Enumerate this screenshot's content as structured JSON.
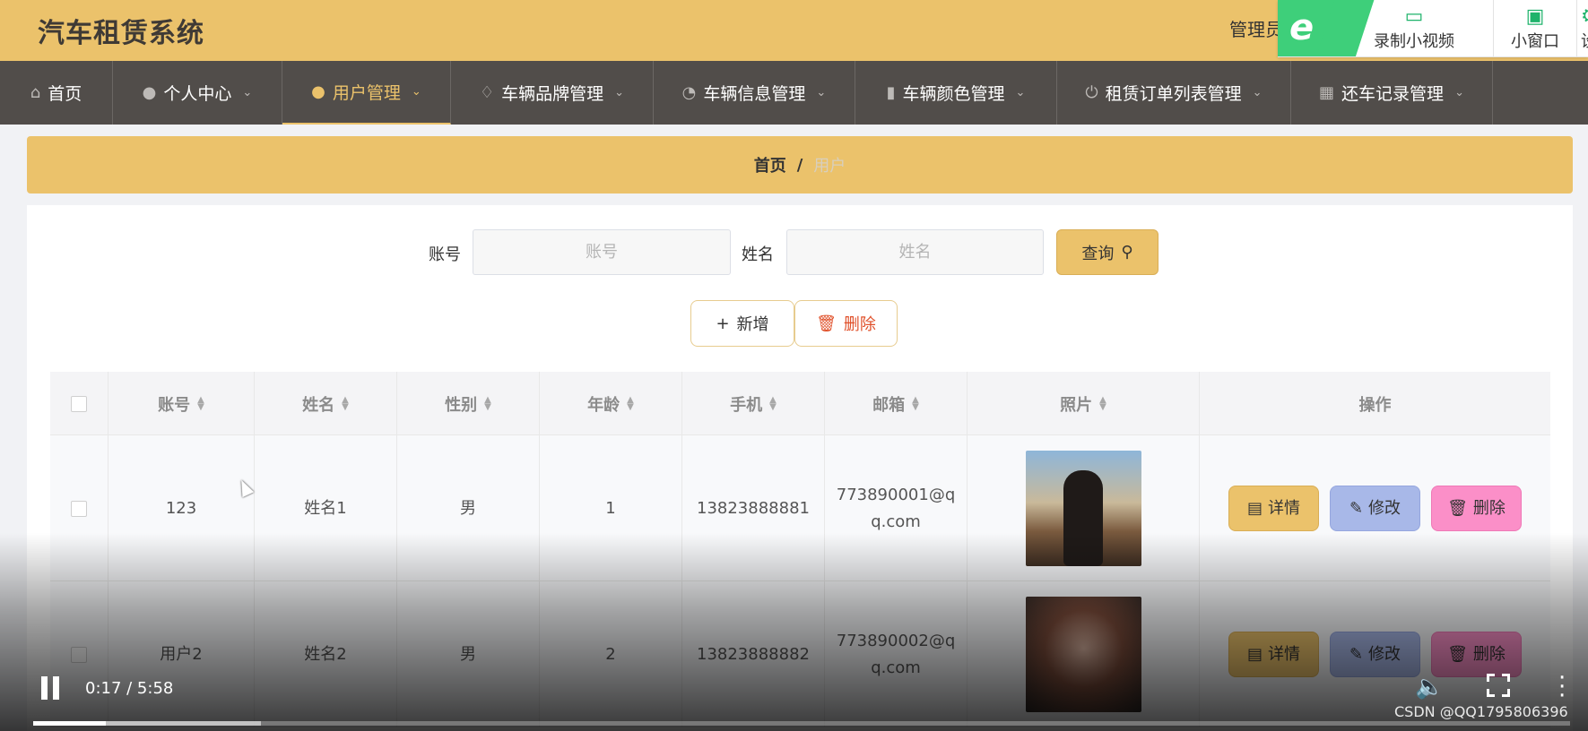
{
  "app": {
    "title": "汽车租赁系统",
    "admin_label": "管理员"
  },
  "recorder": {
    "logo_glyph": "e",
    "items": [
      {
        "label": "录制小视频",
        "icon": "video-camera-icon",
        "glyph": "▭"
      },
      {
        "label": "小窗口",
        "icon": "tv-icon",
        "glyph": "▣"
      },
      {
        "label": "设置",
        "icon": "gear-icon",
        "glyph": "⚙"
      }
    ]
  },
  "nav": {
    "items": [
      {
        "label": "首页",
        "icon": "home-icon",
        "glyph": "⌂",
        "has_caret": false,
        "active": false
      },
      {
        "label": "个人中心",
        "icon": "user-icon",
        "glyph": "●",
        "has_caret": true,
        "active": false
      },
      {
        "label": "用户管理",
        "icon": "user-icon",
        "glyph": "●",
        "has_caret": true,
        "active": true
      },
      {
        "label": "车辆品牌管理",
        "icon": "bell-off-icon",
        "glyph": "♢",
        "has_caret": true,
        "active": false
      },
      {
        "label": "车辆信息管理",
        "icon": "gauge-icon",
        "glyph": "◔",
        "has_caret": true,
        "active": false
      },
      {
        "label": "车辆颜色管理",
        "icon": "bar-chart-icon",
        "glyph": "▮",
        "has_caret": true,
        "active": false
      },
      {
        "label": "租赁订单列表管理",
        "icon": "power-icon",
        "glyph": "⏻",
        "has_caret": true,
        "active": false
      },
      {
        "label": "还车记录管理",
        "icon": "grid-icon",
        "glyph": "▦",
        "has_caret": true,
        "active": false
      }
    ],
    "caret_glyph": "⌄"
  },
  "breadcrumb": {
    "home": "首页",
    "separator": "/",
    "current": "用户"
  },
  "search": {
    "account_label": "账号",
    "account_placeholder": "账号",
    "name_label": "姓名",
    "name_placeholder": "姓名",
    "query_label": "查询",
    "query_icon_glyph": "⚲"
  },
  "actions": {
    "add_label": "新增",
    "add_glyph": "+",
    "delete_label": "删除",
    "delete_glyph": "🗑"
  },
  "table": {
    "columns": [
      "账号",
      "姓名",
      "性别",
      "年龄",
      "手机",
      "邮箱",
      "照片",
      "操作"
    ],
    "rows": [
      {
        "account": "123",
        "name": "姓名1",
        "gender": "男",
        "age": "1",
        "phone": "13823888881",
        "email_line1": "773890001@q",
        "email_line2": "q.com"
      },
      {
        "account": "用户2",
        "name": "姓名2",
        "gender": "男",
        "age": "2",
        "phone": "13823888882",
        "email_line1": "773890002@q",
        "email_line2": "q.com"
      }
    ],
    "op_labels": {
      "detail": "详情",
      "edit": "修改",
      "delete": "删除"
    },
    "op_glyphs": {
      "detail": "▤",
      "edit": "✎",
      "delete": "🗑"
    }
  },
  "video": {
    "time": "0:17 / 5:58",
    "progress_fraction": 0.047,
    "buffered_fraction": 0.148,
    "watermark": "CSDN @QQ1795806396"
  }
}
